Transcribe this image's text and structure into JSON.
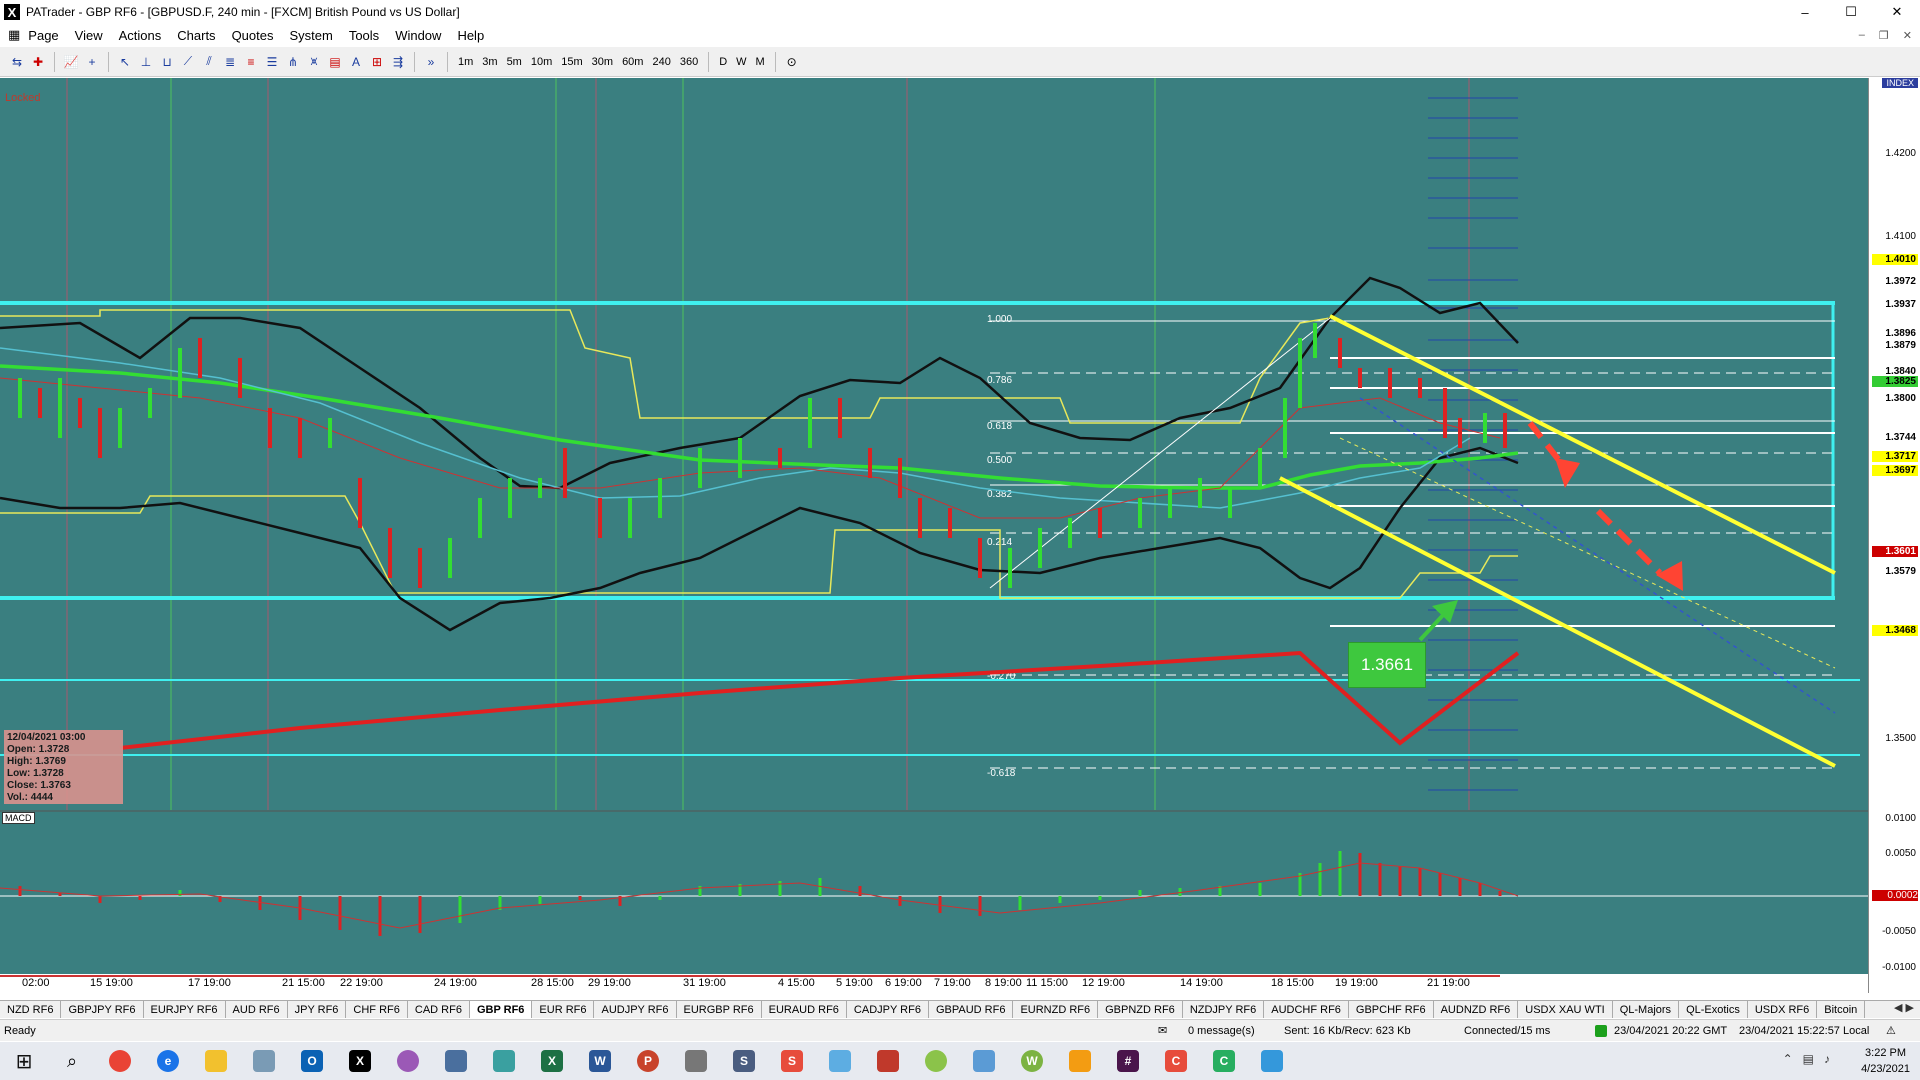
{
  "window": {
    "title": "PATrader - GBP RF6 - [GBPUSD.F, 240 min - [FXCM] British Pound vs US Dollar]",
    "controls": [
      "–",
      "☐",
      "✕"
    ]
  },
  "menu": [
    "Page",
    "View",
    "Actions",
    "Charts",
    "Quotes",
    "System",
    "Tools",
    "Window",
    "Help"
  ],
  "toolbar": {
    "timeframes": [
      "1m",
      "3m",
      "5m",
      "10m",
      "15m",
      "30m",
      "60m",
      "240",
      "360",
      "D",
      "W",
      "M"
    ]
  },
  "chart": {
    "locked_label": "Locked",
    "index_label": "INDEX",
    "macd_label": "MACD",
    "callout_price": "1.3661",
    "info_box": {
      "date": "12/04/2021 03:00",
      "open": "Open: 1.3728",
      "high": "High: 1.3769",
      "low": "Low: 1.3728",
      "close": "Close: 1.3763",
      "vol": "Vol.: 4444"
    },
    "fib_levels": [
      "1.000",
      "0.786",
      "0.618",
      "0.500",
      "0.382",
      "0.214",
      "-0.270",
      "-0.618"
    ],
    "price_ticks": [
      "1.4200",
      "1.4100",
      "1.3500"
    ],
    "price_boxes": [
      {
        "label": "1.4010",
        "bg": "#ffff00"
      },
      {
        "label": "1.3972",
        "bg": "#ffffff"
      },
      {
        "label": "1.3937",
        "bg": "#ffffff"
      },
      {
        "label": "1.3896",
        "bg": "#ffffff"
      },
      {
        "label": "1.3879",
        "bg": "#ffffff"
      },
      {
        "label": "1.3840",
        "bg": "#ffffff"
      },
      {
        "label": "1.3825",
        "bg": "#33cc33"
      },
      {
        "label": "1.3800",
        "bg": "#ffffff"
      },
      {
        "label": "1.3744",
        "bg": "#ffffff"
      },
      {
        "label": "1.3717",
        "bg": "#ffff00"
      },
      {
        "label": "1.3697",
        "bg": "#ffff00"
      },
      {
        "label": "1.3601",
        "bg": "#cc0000"
      },
      {
        "label": "1.3579",
        "bg": "#ffffff"
      },
      {
        "label": "1.3468",
        "bg": "#ffff00"
      }
    ],
    "macd_ticks": [
      "0.0100",
      "0.0050",
      "0.0002",
      "-0.0050",
      "-0.0100"
    ],
    "time_axis": [
      "02:00",
      "15 19:00",
      "17 19:00",
      "21 15:00",
      "22 19:00",
      "24 19:00",
      "28 15:00",
      "29 19:00",
      "31 19:00",
      "4 15:00",
      "5 19:00",
      "6 19:00",
      "7 19:00",
      "8 19:00",
      "11 15:00",
      "12 19:00",
      "14 19:00",
      "18 15:00",
      "19 19:00",
      "21 19:00"
    ]
  },
  "tabs": [
    "NZD RF6",
    "GBPJPY RF6",
    "EURJPY RF6",
    "AUD RF6",
    "JPY RF6",
    "CHF RF6",
    "CAD RF6",
    "GBP RF6",
    "EUR RF6",
    "AUDJPY RF6",
    "EURGBP RF6",
    "EURAUD RF6",
    "CADJPY RF6",
    "GBPAUD RF6",
    "EURNZD RF6",
    "GBPNZD RF6",
    "NZDJPY RF6",
    "AUDCHF RF6",
    "GBPCHF RF6",
    "AUDNZD RF6",
    "USDX XAU WTI",
    "QL-Majors",
    "QL-Exotics",
    "USDX RF6",
    "Bitcoin"
  ],
  "active_tab": "GBP RF6",
  "status": {
    "ready": "Ready",
    "messages": "0 message(s)",
    "traffic": "Sent: 16 Kb/Recv: 623 Kb",
    "connection": "Connected/15 ms",
    "gmt": "23/04/2021 20:22 GMT",
    "local": "23/04/2021 15:22:57 Local"
  },
  "taskbar": {
    "time": "3:22 PM",
    "date": "4/23/2021"
  }
}
